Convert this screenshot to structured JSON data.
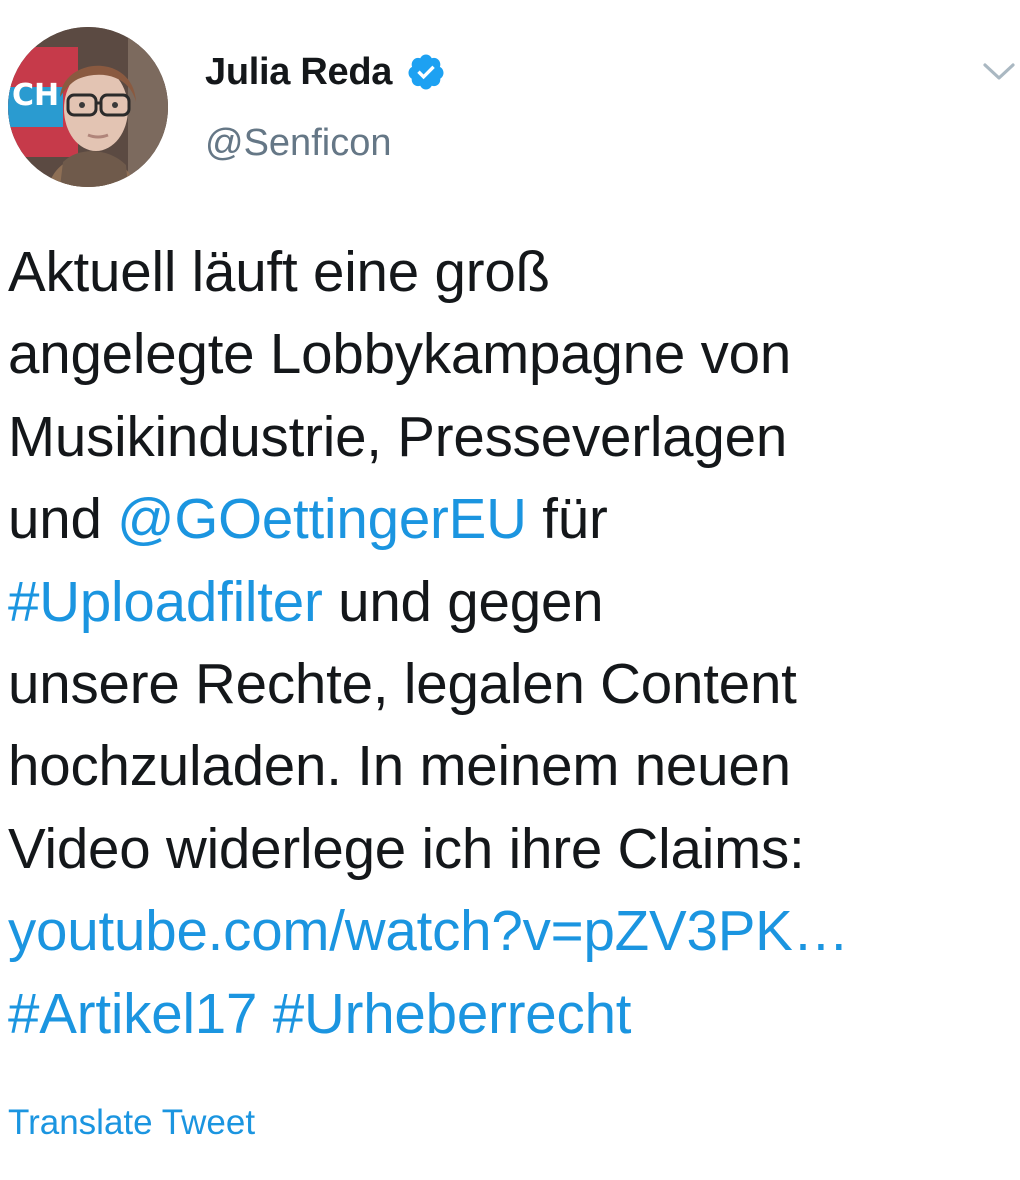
{
  "author": {
    "display_name": "Julia Reda",
    "handle": "@Senficon",
    "verified": true,
    "avatar_icon": "avatar-photo"
  },
  "menu": {
    "icon": "chevron-down-icon"
  },
  "tweet": {
    "line1": "Aktuell läuft eine groß",
    "line2": "angelegte Lobbykampagne von",
    "line3": "Musikindustrie, Presseverlagen",
    "line4_a": "und ",
    "line4_mention": "@GOettingerEU",
    "line4_b": " für",
    "line5_hashtag": "#Uploadfilter",
    "line5_b": " und gegen",
    "line6": "unsere Rechte, legalen Content",
    "line7": "hochzuladen. In meinem neuen",
    "line8": "Video widerlege ich ihre Claims:",
    "line9_link": "youtube.com/watch?v=pZV3PK…",
    "line10_hashtag1": "#Artikel17",
    "line10_space": " ",
    "line10_hashtag2": "#Urheberrecht"
  },
  "translate_label": "Translate Tweet",
  "colors": {
    "text": "#14171a",
    "link": "#1b95e0",
    "secondary": "#657786",
    "verified": "#1da1f2"
  }
}
